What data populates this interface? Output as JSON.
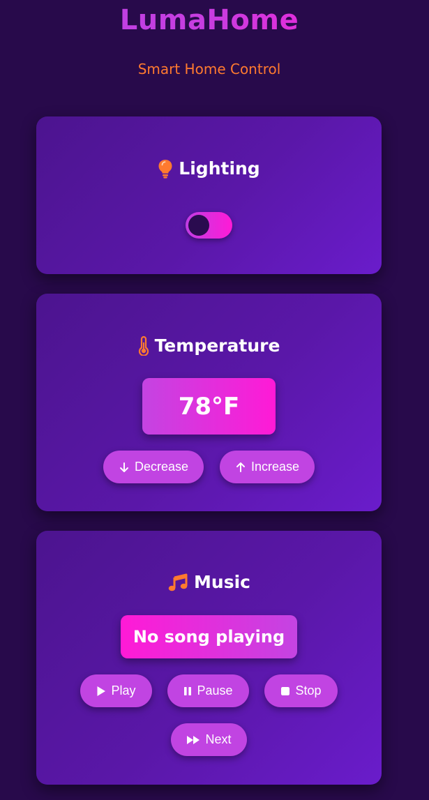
{
  "app": {
    "title": "LumaHome",
    "subtitle": "Smart Home Control"
  },
  "colors": {
    "background": "#280a4b",
    "title_gradient_start": "#b643e6",
    "title_gradient_end": "#ff1ad6",
    "accent_orange": "#ff7a2f",
    "button": "#c144e2",
    "card": "#5a17a8"
  },
  "lighting": {
    "heading": "Lighting",
    "icon": "lightbulb-icon",
    "toggle_on": false
  },
  "temperature": {
    "heading": "Temperature",
    "icon": "thermometer-icon",
    "value": "78°F",
    "decrease_label": "Decrease",
    "decrease_icon": "arrow-down-icon",
    "increase_label": "Increase",
    "increase_icon": "arrow-up-icon"
  },
  "music": {
    "heading": "Music",
    "icon": "music-note-icon",
    "now_playing": "No song playing",
    "play_label": "Play",
    "play_icon": "play-icon",
    "pause_label": "Pause",
    "pause_icon": "pause-icon",
    "stop_label": "Stop",
    "stop_icon": "stop-icon",
    "next_label": "Next",
    "next_icon": "fast-forward-icon"
  }
}
